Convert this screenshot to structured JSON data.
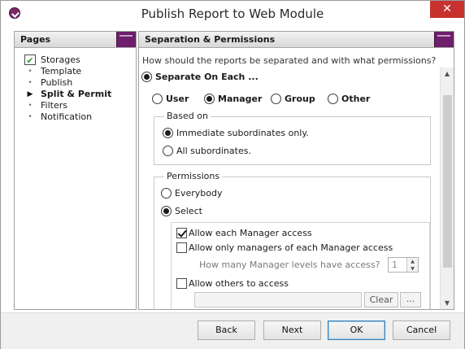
{
  "window": {
    "title": "Publish Report to Web Module",
    "close_symbol": "✕"
  },
  "sidebar": {
    "header": "Pages",
    "items": [
      {
        "label": "Storages",
        "marker": "check-icon",
        "state": "done"
      },
      {
        "label": "Template",
        "marker": "dot-icon",
        "state": "pending"
      },
      {
        "label": "Publish",
        "marker": "dot-icon",
        "state": "pending"
      },
      {
        "label": "Split & Permit",
        "marker": "arrow-icon",
        "state": "current"
      },
      {
        "label": "Filters",
        "marker": "dot-icon",
        "state": "pending"
      },
      {
        "label": "Notification",
        "marker": "dot-icon",
        "state": "pending"
      }
    ]
  },
  "main": {
    "header": "Separation & Permissions",
    "question": "How should the reports be separated and with what permissions?",
    "separate_label": "Separate On Each ...",
    "separate_selected": true,
    "separate_options": [
      {
        "label": "User",
        "selected": false
      },
      {
        "label": "Manager",
        "selected": true
      },
      {
        "label": "Group",
        "selected": false
      },
      {
        "label": "Other",
        "selected": false
      }
    ],
    "based_on": {
      "title": "Based on",
      "options": [
        {
          "label": "Immediate subordinates only.",
          "selected": true
        },
        {
          "label": "All subordinates.",
          "selected": false
        }
      ]
    },
    "permissions": {
      "title": "Permissions",
      "options": [
        {
          "label": "Everybody",
          "selected": false
        },
        {
          "label": "Select",
          "selected": true
        }
      ],
      "allow_each": {
        "label": "Allow each Manager access",
        "checked": true
      },
      "allow_only": {
        "label": "Allow only managers of each Manager access",
        "checked": false
      },
      "levels": {
        "label": "How many Manager levels have access?",
        "value": "1"
      },
      "allow_others": {
        "label": "Allow others to access",
        "checked": false
      },
      "others_value": "",
      "clear_label": "Clear",
      "ellipsis_label": "..."
    }
  },
  "footer": {
    "back": "Back",
    "next": "Next",
    "ok": "OK",
    "cancel": "Cancel"
  },
  "colors": {
    "accent": "#6d1f6a",
    "close": "#c7322f",
    "done_check": "#2e9b2e"
  }
}
